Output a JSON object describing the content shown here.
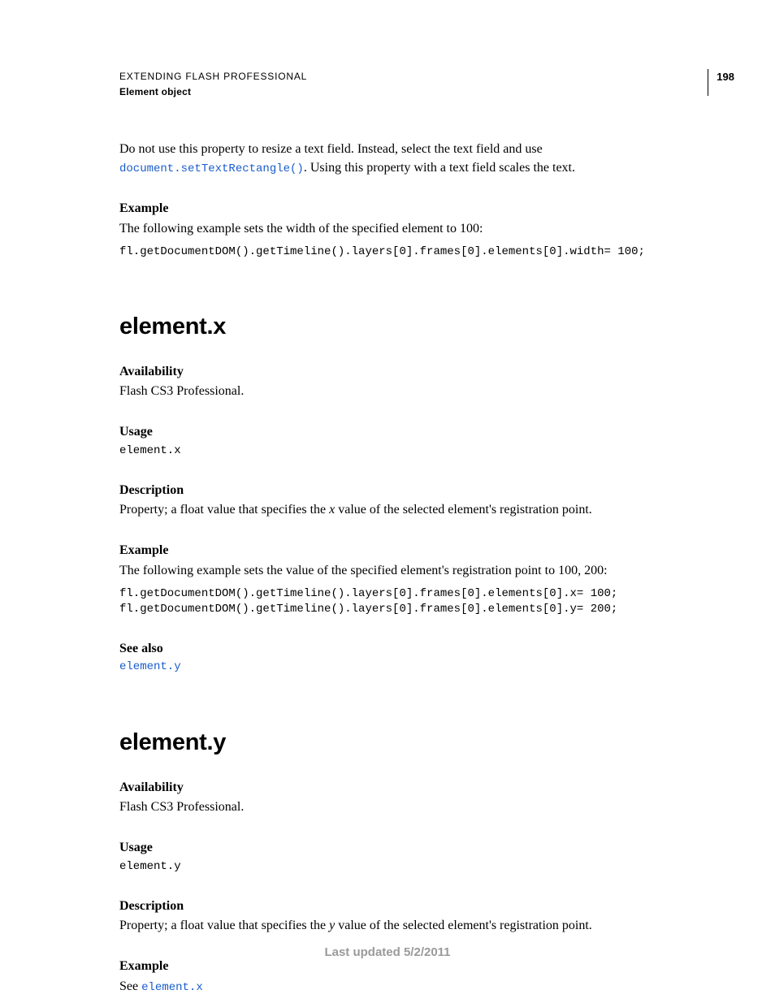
{
  "header": {
    "title": "EXTENDING FLASH PROFESSIONAL",
    "subtitle": "Element object",
    "page_number": "198"
  },
  "intro": {
    "para_prefix": "Do not use this property to resize a text field. Instead, select the text field and use ",
    "link": "document.setTextRectangle()",
    "para_suffix": ". Using this property with a text field scales the text.",
    "example_label": "Example",
    "example_text": "The following example sets the width of the specified element to 100:",
    "example_code": "fl.getDocumentDOM().getTimeline().layers[0].frames[0].elements[0].width= 100;"
  },
  "section_x": {
    "heading": "element.x",
    "availability_label": "Availability",
    "availability_text": "Flash CS3 Professional.",
    "usage_label": "Usage",
    "usage_code": "element.x",
    "description_label": "Description",
    "description_prefix": "Property; a float value that specifies the ",
    "description_var": "x",
    "description_suffix": " value of the selected element's registration point.",
    "example_label": "Example",
    "example_text": "The following example sets the value of the specified element's registration point to 100, 200:",
    "example_code": "fl.getDocumentDOM().getTimeline().layers[0].frames[0].elements[0].x= 100; \nfl.getDocumentDOM().getTimeline().layers[0].frames[0].elements[0].y= 200;",
    "see_also_label": "See also",
    "see_also_link": "element.y"
  },
  "section_y": {
    "heading": "element.y",
    "availability_label": "Availability",
    "availability_text": "Flash CS3 Professional.",
    "usage_label": "Usage",
    "usage_code": "element.y",
    "description_label": "Description",
    "description_prefix": "Property; a float value that specifies the ",
    "description_var": "y",
    "description_suffix": " value of the selected element's registration point.",
    "example_label": "Example",
    "example_prefix": "See ",
    "example_link": "element.x"
  },
  "footer": {
    "text": "Last updated 5/2/2011"
  }
}
